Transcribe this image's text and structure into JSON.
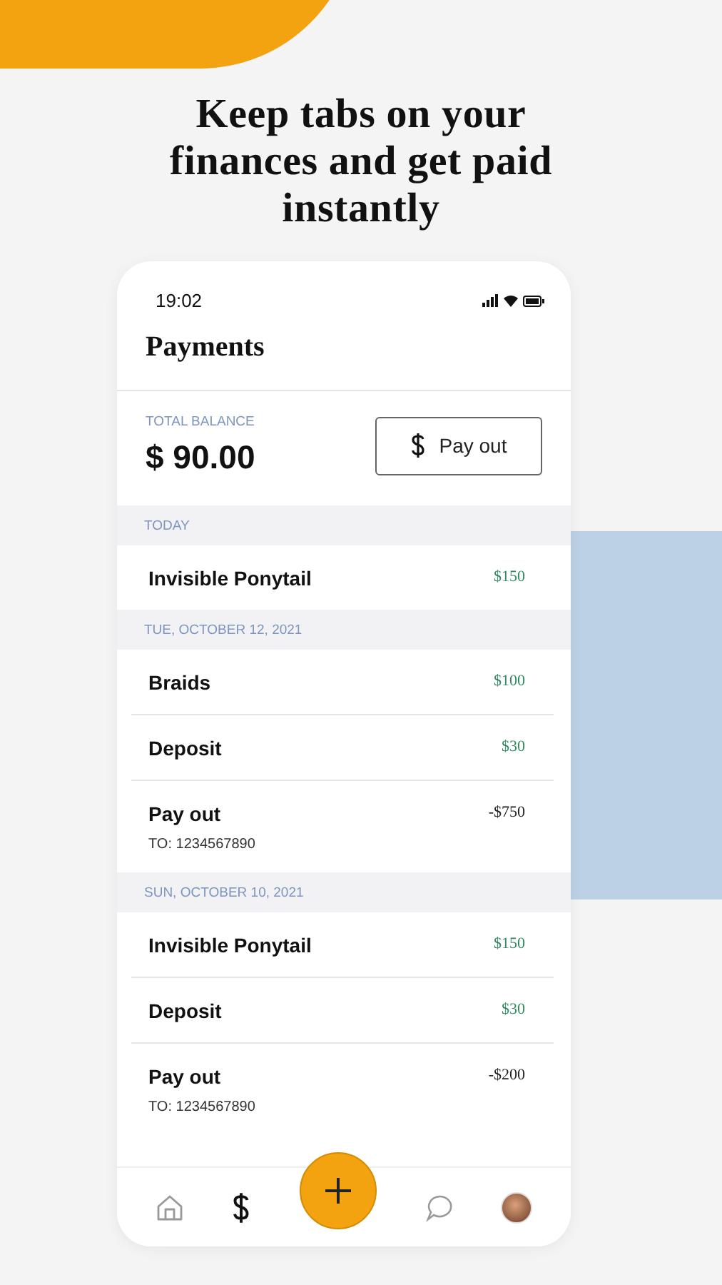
{
  "headline": "Keep tabs on your finances and get paid instantly",
  "status_bar": {
    "time": "19:02"
  },
  "title": "Payments",
  "balance": {
    "label": "TOTAL BALANCE",
    "amount": "$ 90.00"
  },
  "pay_out_button": {
    "label": "Pay out"
  },
  "groups": [
    {
      "date": "TODAY",
      "transactions": [
        {
          "name": "Invisible Ponytail",
          "amount": "$150",
          "kind": "credit"
        }
      ]
    },
    {
      "date": "TUE, OCTOBER 12, 2021",
      "transactions": [
        {
          "name": "Braids",
          "amount": "$100",
          "kind": "credit"
        },
        {
          "name": "Deposit",
          "amount": "$30",
          "kind": "credit"
        },
        {
          "name": "Pay out",
          "amount": "-$750",
          "kind": "debit",
          "subtitle": "TO: 1234567890"
        }
      ]
    },
    {
      "date": "SUN, OCTOBER 10, 2021",
      "transactions": [
        {
          "name": "Invisible Ponytail",
          "amount": "$150",
          "kind": "credit"
        },
        {
          "name": "Deposit",
          "amount": "$30",
          "kind": "credit"
        },
        {
          "name": "Pay out",
          "amount": "-$200",
          "kind": "debit",
          "subtitle": "TO: 1234567890"
        }
      ]
    }
  ],
  "nav": [
    {
      "kind": "home",
      "selected": false
    },
    {
      "kind": "money",
      "selected": true
    },
    {
      "kind": "add",
      "selected": false
    },
    {
      "kind": "chat",
      "selected": false
    },
    {
      "kind": "profile",
      "selected": false
    }
  ]
}
